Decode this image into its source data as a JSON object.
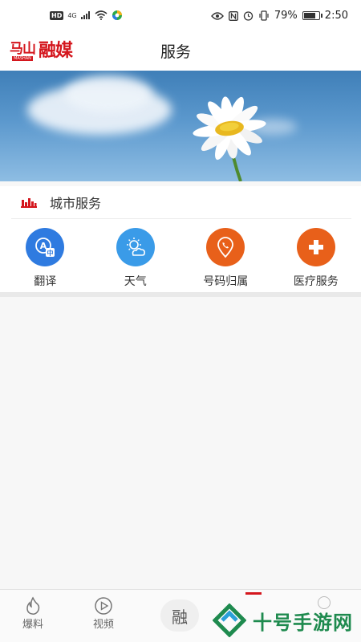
{
  "status_bar": {
    "hd": "HD",
    "network": "4G",
    "battery_pct": "79%",
    "battery_level": 0.79,
    "time": "2:50"
  },
  "header": {
    "logo_small": "马山",
    "logo_small_sub": "MASHAN",
    "logo_big": "融媒",
    "title": "服务"
  },
  "section": {
    "title": "城市服务"
  },
  "services": [
    {
      "label": "翻译",
      "icon": "translate-icon",
      "color": "#2f7be0"
    },
    {
      "label": "天气",
      "icon": "weather-icon",
      "color": "#3a9be8"
    },
    {
      "label": "号码归属",
      "icon": "phone-location-icon",
      "color": "#e8601a"
    },
    {
      "label": "医疗服务",
      "icon": "medical-plus-icon",
      "color": "#e8601a"
    }
  ],
  "bottom_nav": {
    "items": [
      {
        "label": "爆料",
        "icon": "flame-icon"
      },
      {
        "label": "视频",
        "icon": "play-icon"
      }
    ],
    "center_label": "融"
  },
  "watermark": {
    "text": "十号手游网"
  },
  "colors": {
    "brand": "#d4161d",
    "blue": "#2f7be0",
    "orange": "#e8601a"
  }
}
